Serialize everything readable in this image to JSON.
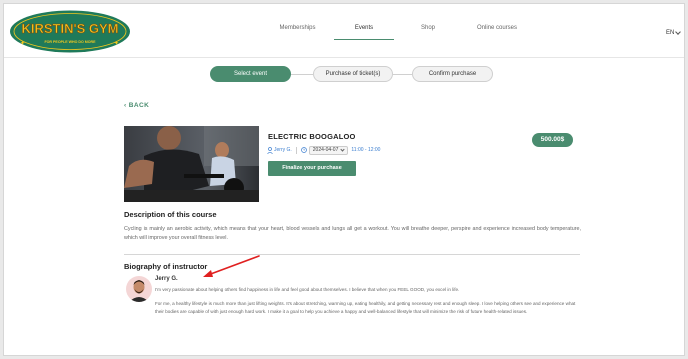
{
  "header": {
    "logo_text": "KIRSTIN'S GYM",
    "logo_subtext": "FOR PEOPLE WHO DO MORE",
    "nav": [
      "Memberships",
      "Events",
      "Shop",
      "Online courses"
    ],
    "active_nav": "Events",
    "language": "EN"
  },
  "stepper": {
    "steps": [
      "Select event",
      "Purchase of ticket(s)",
      "Confirm purchase"
    ],
    "active_step": "Select event"
  },
  "back_label": "BACK",
  "event": {
    "title": "ELECTRIC BOOGALOO",
    "instructor_short": "Jerry G.",
    "date": "2024-04-07",
    "time": "11:00 - 12:00",
    "finalize_label": "Finalize your purchase",
    "price": "500.00$"
  },
  "description": {
    "heading": "Description of this course",
    "text": "Cycling is mainly an aerobic activity, which means that your heart, blood vessels and lungs all get a workout. You will breathe deeper, perspire and experience increased body temperature, which will improve your overall fitness level."
  },
  "biography": {
    "heading": "Biography of instructor",
    "name": "Jerry G.",
    "para1": "I'm very passionate about helping others find happiness in life and feel good about themselves. I believe that when you FEEL GOOD, you excel in life.",
    "para2": "For me, a healthy lifestyle is much more than just lifting weights. It's about stretching, warming up, eating healthily, and getting necessary rest and enough sleep. I love helping others see and experience what their bodies are capable of with just enough hard work. I make it a goal to help you achieve a happy and well-balanced lifestyle that will minimize the risk of future health-related issues."
  },
  "colors": {
    "brand_green": "#4a8c6f",
    "logo_yellow": "#f2c81e",
    "link_blue": "#3d7fd0",
    "annotation_red": "#e02020"
  }
}
